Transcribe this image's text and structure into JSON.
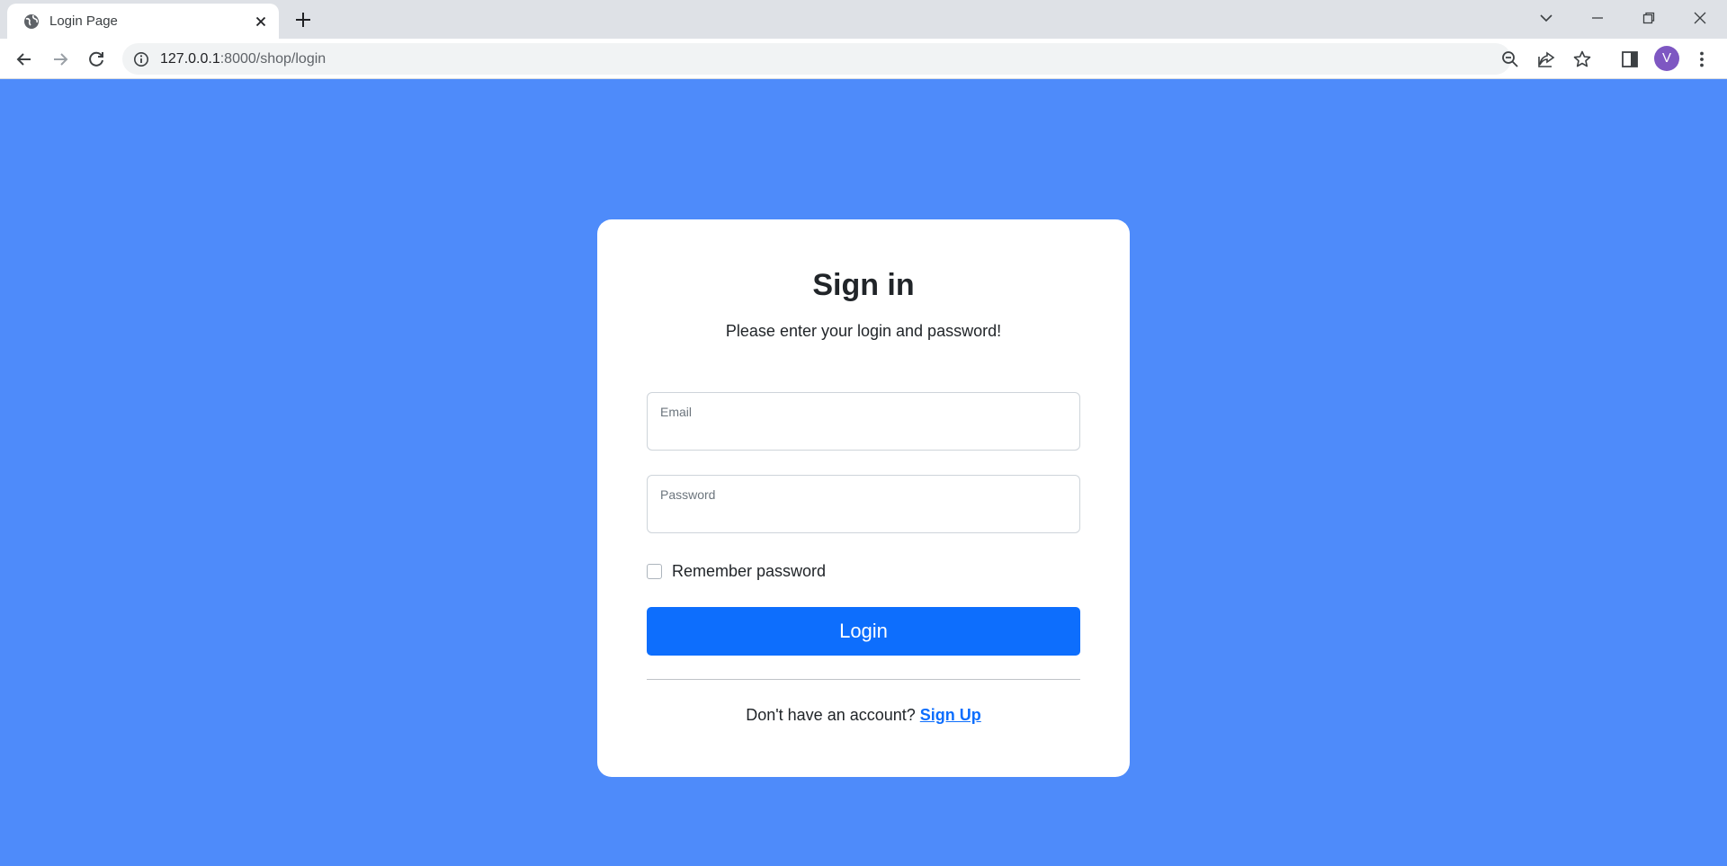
{
  "browser": {
    "tab_title": "Login Page",
    "url_host": "127.0.0.1",
    "url_rest": ":8000/shop/login",
    "avatar_letter": "V",
    "icons": {
      "favicon": "globe-icon",
      "tab_close": "close-icon",
      "new_tab": "plus-icon",
      "tab_search": "chevron-down-icon",
      "minimize": "minimize-icon",
      "restore": "restore-icon",
      "close_window": "close-icon",
      "back": "arrow-left-icon",
      "forward": "arrow-right-icon",
      "reload": "reload-icon",
      "site_info": "info-icon",
      "zoom": "zoom-out-icon",
      "share": "share-icon",
      "bookmark": "star-icon",
      "side_panel": "side-panel-icon",
      "menu": "kebab-menu-icon"
    }
  },
  "page": {
    "background_color": "#4e8bfa",
    "title": "Sign in",
    "subtitle": "Please enter your login and password!",
    "email_label": "Email",
    "email_value": "",
    "password_label": "Password",
    "password_value": "",
    "remember_label": "Remember password",
    "remember_checked": false,
    "login_label": "Login",
    "signup_prompt": "Don't have an account? ",
    "signup_link": "Sign Up",
    "accent_color": "#0d6efd"
  }
}
